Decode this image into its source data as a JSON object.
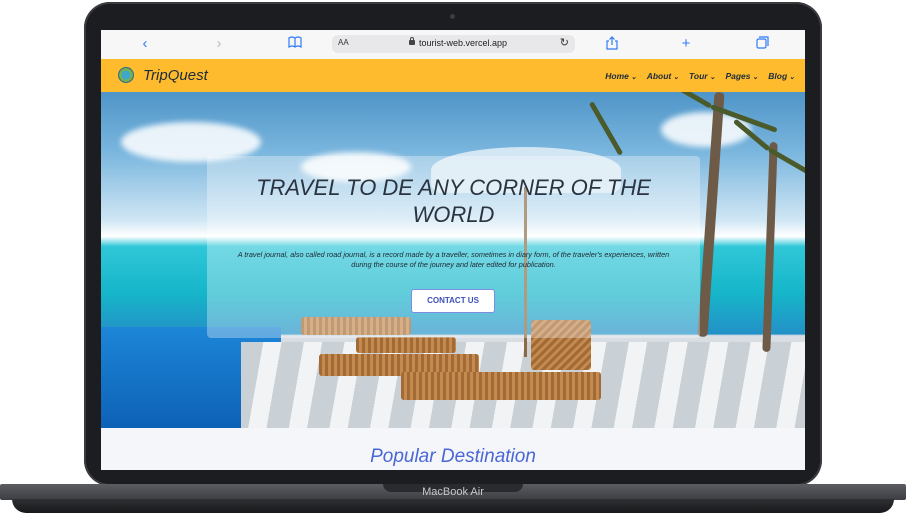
{
  "device": {
    "label": "MacBook Air"
  },
  "browser": {
    "url": "tourist-web.vercel.app",
    "text_size_label": "AA"
  },
  "site": {
    "name": "TripQuest",
    "menu": [
      "Home",
      "About",
      "Tour",
      "Pages",
      "Blog"
    ],
    "accent_color": "#fdbb2d"
  },
  "hero": {
    "title": "TRAVEL TO DE ANY CORNER OF THE WORLD",
    "description": "A travel journal, also called road journal, is a record made by a traveller, sometimes in diary form, of the traveler's experiences, written during the course of the journey and later edited for publication.",
    "cta_label": "CONTACT US"
  },
  "section": {
    "title": "Popular Destination"
  }
}
